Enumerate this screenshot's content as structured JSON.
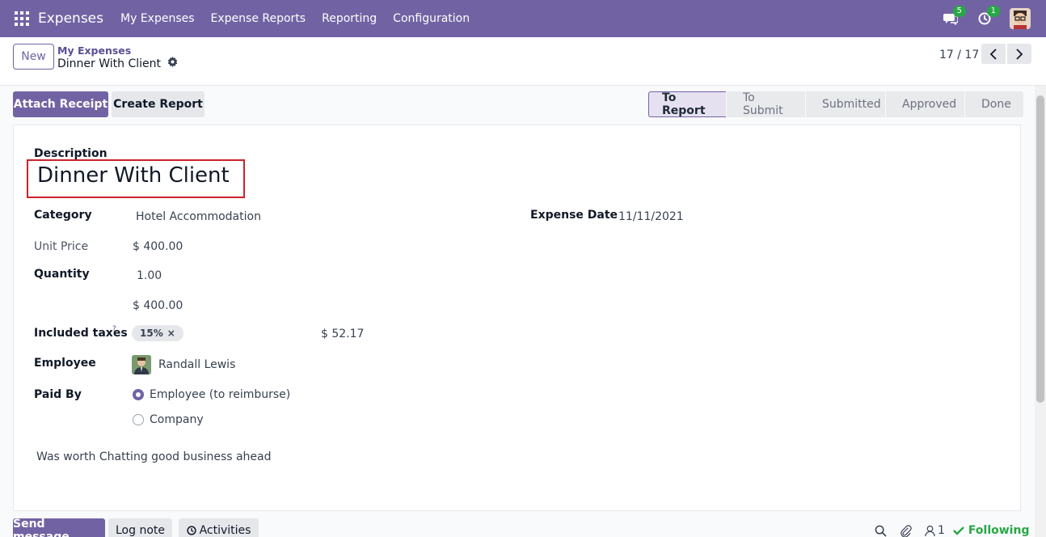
{
  "navbar": {
    "app_name": "Expenses",
    "menu": [
      "My Expenses",
      "Expense Reports",
      "Reporting",
      "Configuration"
    ],
    "chat_badge": "5",
    "activity_badge": "1",
    "accent": "#7163a3"
  },
  "control": {
    "new_label": "New",
    "breadcrumb_parent": "My Expenses",
    "breadcrumb_current": "Dinner With Client",
    "pager": "17 / 17"
  },
  "actions": {
    "attach_receipt": "Attach Receipt",
    "create_report": "Create Report"
  },
  "status": {
    "stages": [
      "To Report",
      "To Submit",
      "Submitted",
      "Approved",
      "Done"
    ],
    "active": "To Report"
  },
  "form": {
    "description_label": "Description",
    "title": "Dinner With Client",
    "category_label": "Category",
    "category": "Hotel Accommodation",
    "expense_date_label": "Expense Date",
    "expense_date": "11/11/2021",
    "unit_price_label": "Unit Price",
    "unit_price": "$ 400.00",
    "quantity_label": "Quantity",
    "quantity": "1.00",
    "total": "$ 400.00",
    "taxes_label": "Included taxes",
    "taxes_help": "?",
    "tax_tag": "15%",
    "tax_remove": "×",
    "tax_amount": "$ 52.17",
    "employee_label": "Employee",
    "employee": "Randall Lewis",
    "paid_by_label": "Paid By",
    "paid_by_options": [
      "Employee (to reimburse)",
      "Company"
    ],
    "paid_by_selected": "Employee (to reimburse)",
    "notes": "Was worth Chatting good business ahead"
  },
  "chatter": {
    "send_message": "Send message",
    "log_note": "Log note",
    "activities": "Activities",
    "followers_count": "1",
    "following": "Following"
  }
}
